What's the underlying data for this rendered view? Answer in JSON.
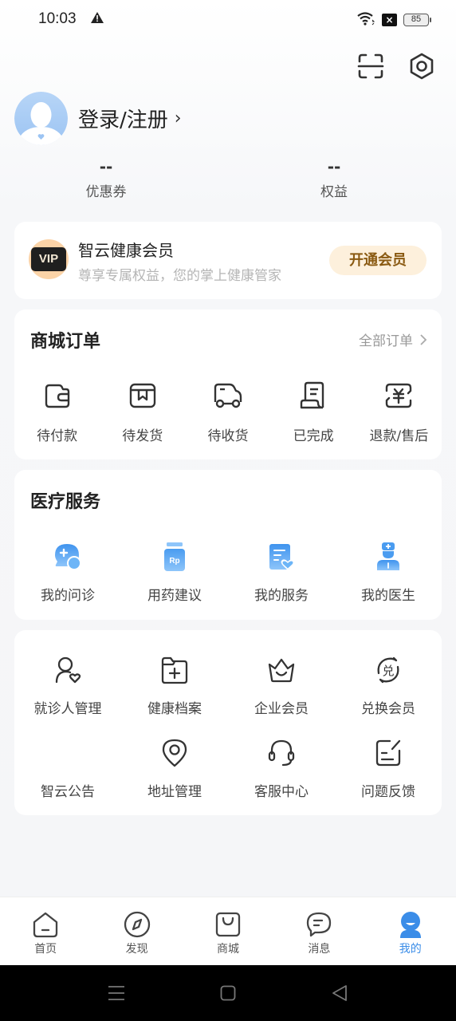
{
  "status_bar": {
    "time": "10:03",
    "battery": "85",
    "warning_icon": "warning-icon",
    "wifi_icon": "wifi-icon",
    "sim_icon": "no-sim-icon"
  },
  "header": {
    "scan_icon": "scan-icon",
    "settings_icon": "settings-hexagon-icon"
  },
  "profile": {
    "login_label": "登录/注册",
    "chevron": "›"
  },
  "stats": [
    {
      "value": "--",
      "label": "优惠券"
    },
    {
      "value": "--",
      "label": "权益"
    }
  ],
  "vip": {
    "badge": "VIP",
    "title": "智云健康会员",
    "subtitle": "尊享专属权益，您的掌上健康管家",
    "button": "开通会员"
  },
  "orders": {
    "title": "商城订单",
    "all_label": "全部订单",
    "items": [
      {
        "label": "待付款",
        "icon": "wallet-icon"
      },
      {
        "label": "待发货",
        "icon": "package-icon"
      },
      {
        "label": "待收货",
        "icon": "truck-icon"
      },
      {
        "label": "已完成",
        "icon": "receipt-icon"
      },
      {
        "label": "退款/售后",
        "icon": "refund-yen-icon"
      }
    ]
  },
  "medical": {
    "title": "医疗服务",
    "items": [
      {
        "label": "我的问诊",
        "icon": "consultation-chat-icon"
      },
      {
        "label": "用药建议",
        "icon": "rx-bottle-icon"
      },
      {
        "label": "我的服务",
        "icon": "service-document-icon"
      },
      {
        "label": "我的医生",
        "icon": "doctor-icon"
      }
    ]
  },
  "tools": {
    "items": [
      {
        "label": "就诊人管理",
        "icon": "patient-heart-icon"
      },
      {
        "label": "健康档案",
        "icon": "health-folder-icon"
      },
      {
        "label": "企业会员",
        "icon": "crown-icon"
      },
      {
        "label": "兑换会员",
        "icon": "exchange-icon"
      },
      {
        "label": "智云公告",
        "icon": ""
      },
      {
        "label": "地址管理",
        "icon": "location-pin-icon"
      },
      {
        "label": "客服中心",
        "icon": "headset-icon"
      },
      {
        "label": "问题反馈",
        "icon": "feedback-edit-icon"
      }
    ]
  },
  "tabbar": {
    "active_color": "#3b8de8",
    "items": [
      {
        "label": "首页",
        "icon": "home-icon"
      },
      {
        "label": "发现",
        "icon": "compass-icon"
      },
      {
        "label": "商城",
        "icon": "shopping-bag-icon"
      },
      {
        "label": "消息",
        "icon": "message-icon"
      },
      {
        "label": "我的",
        "icon": "profile-icon",
        "active": true
      }
    ]
  },
  "system_nav": {
    "menu_icon": "menu-icon",
    "home_icon": "square-home-icon",
    "back_icon": "back-triangle-icon"
  }
}
